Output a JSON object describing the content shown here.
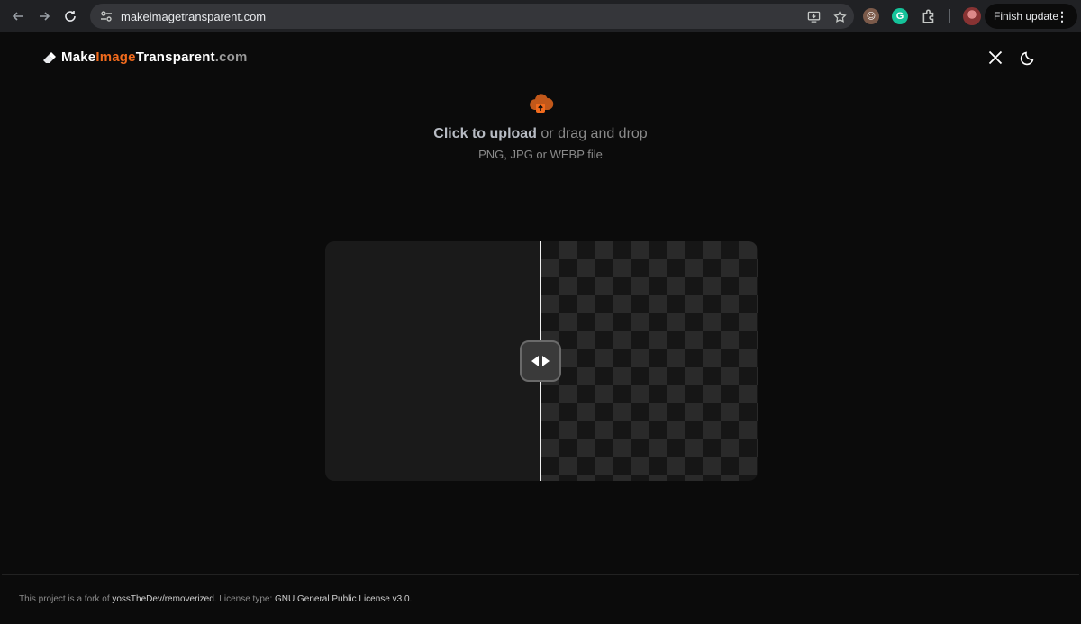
{
  "browser": {
    "url": "makeimagetransparent.com",
    "finish_update_label": "Finish update",
    "menu_glyph": "⋮",
    "extension_g_letter": "G"
  },
  "header": {
    "logo_part1": "Make",
    "logo_part2": "Image",
    "logo_part3": "Transparent",
    "logo_part4": ".com",
    "accent_color": "#f26b1d"
  },
  "upload": {
    "click_text": "Click to upload",
    "drag_text": " or drag and drop",
    "file_types": "PNG, JPG or WEBP file"
  },
  "compare": {
    "split_fraction": 0.5
  },
  "footer": {
    "text1": "This project is a fork of ",
    "link1": "yossTheDev/removerized",
    "text2": ". License type: ",
    "link2": "GNU General Public License v3.0",
    "text3": "."
  }
}
